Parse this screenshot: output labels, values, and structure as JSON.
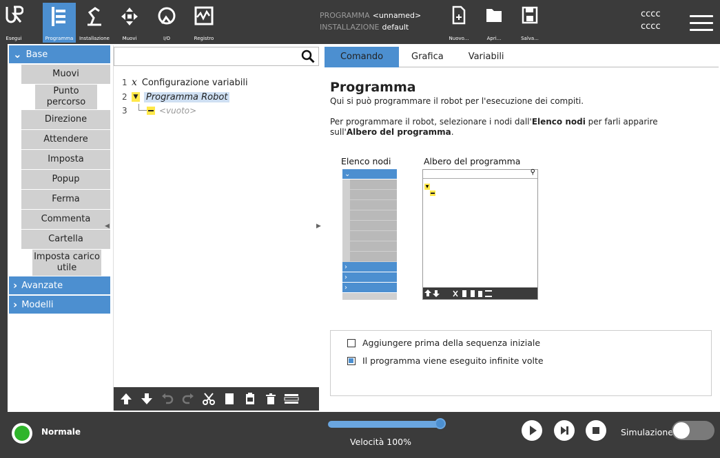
{
  "topbar": {
    "buttons": [
      {
        "label": "Esegui"
      },
      {
        "label": "Programma"
      },
      {
        "label": "Installazione"
      },
      {
        "label": "Muovi"
      },
      {
        "label": "I/O"
      },
      {
        "label": "Registro"
      }
    ],
    "program_key": "PROGRAMMA",
    "program_value": "<unnamed>",
    "installation_key": "INSTALLAZIONE",
    "installation_value": "default",
    "file_actions": [
      {
        "label": "Nuovo..."
      },
      {
        "label": "Apri..."
      },
      {
        "label": "Salva..."
      }
    ],
    "ccc_line1": "cccc",
    "ccc_line2": "cccc"
  },
  "sidebar": {
    "base_label": "Base",
    "items": [
      {
        "label": "Muovi"
      },
      {
        "label": "Punto percorso"
      },
      {
        "label": "Direzione"
      },
      {
        "label": "Attendere"
      },
      {
        "label": "Imposta"
      },
      {
        "label": "Popup"
      },
      {
        "label": "Ferma"
      },
      {
        "label": "Commenta"
      },
      {
        "label": "Cartella"
      },
      {
        "label": "Imposta carico utile"
      }
    ],
    "advanced_label": "Avanzate",
    "templates_label": "Modelli"
  },
  "tree": {
    "search_value": "",
    "lines": [
      {
        "num": "1",
        "icon": "x",
        "text": "Configurazione variabili"
      },
      {
        "num": "2",
        "icon": "▼",
        "text": "Programma Robot"
      },
      {
        "num": "3",
        "icon": "",
        "text": "<vuoto>"
      }
    ]
  },
  "tabs": [
    {
      "label": "Comando"
    },
    {
      "label": "Grafica"
    },
    {
      "label": "Variabili"
    }
  ],
  "content": {
    "title": "Programma",
    "subtitle": "Qui si può programmare il robot per l'esecuzione dei compiti.",
    "desc_part1": "Per programmare il robot, selezionare i nodi dall'",
    "desc_bold1": "Elenco nodi",
    "desc_part2": " per farli apparire sull'",
    "desc_bold2": "Albero del programma",
    "desc_part3": ".",
    "mini_nodes_title": "Elenco nodi",
    "mini_tree_title": "Albero del programma",
    "option1_label": "Aggiungere prima della sequenza iniziale",
    "option1_checked": false,
    "option2_label": "Il programma viene eseguito infinite volte",
    "option2_checked": true
  },
  "bottombar": {
    "status": "Normale",
    "speed_label": "Velocità 100%",
    "speed_value": 1.0,
    "sim_label": "Simulazione",
    "sim_enabled": false
  },
  "colors": {
    "accent": "#4c8fd0",
    "bar": "#3b3b3b",
    "status_ok": "#2fb52b"
  }
}
